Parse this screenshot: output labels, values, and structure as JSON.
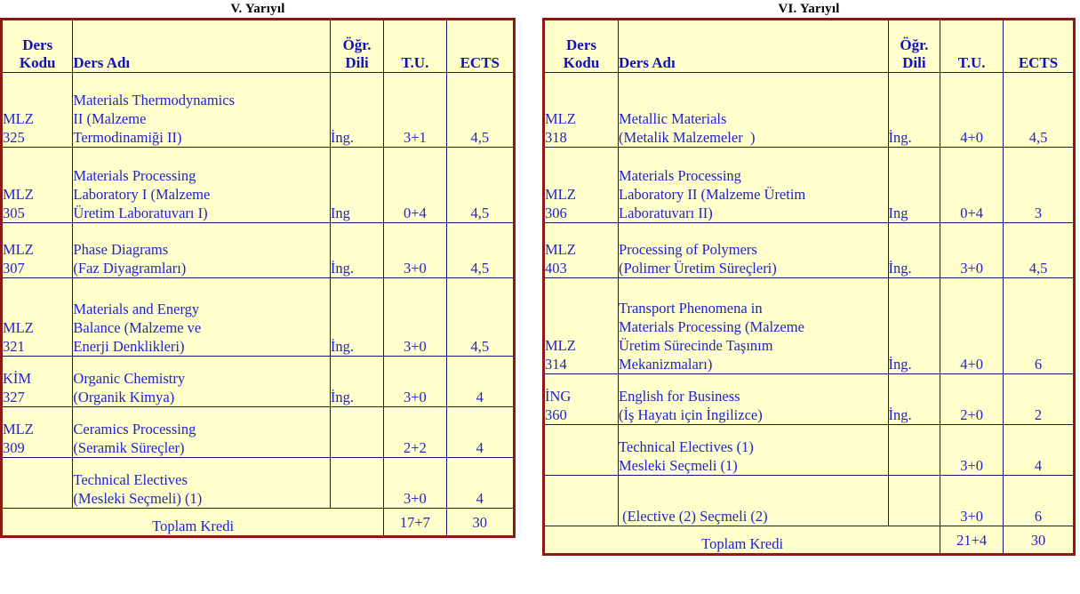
{
  "semesters": [
    {
      "title": "V. Yarıyıl",
      "columns": {
        "code": "Ders\nKodu",
        "code_line1": "Ders",
        "code_line2": "Kodu",
        "name": "Ders Adı",
        "lang_line1": "Öğr.",
        "lang_line2": "Dili",
        "tu": "T.U.",
        "ects": "ECTS"
      },
      "rows": [
        {
          "code_line1": "MLZ",
          "code_line2": "325",
          "name_lines": [
            "Materials Thermodynamics",
            "II (Malzeme",
            "Termodinamiği II)"
          ],
          "lang": "İng.",
          "tu": "3+1",
          "ects": "4,5"
        },
        {
          "code_line1": "MLZ",
          "code_line2": "305",
          "name_lines": [
            "Materials Processing",
            "Laboratory I (Malzeme",
            "Üretim Laboratuvarı I)"
          ],
          "lang": "Ing",
          "tu": "0+4",
          "ects": "4,5"
        },
        {
          "code_line1": "MLZ",
          "code_line2": "307",
          "name_lines": [
            "Phase Diagrams",
            "(Faz Diyagramları)"
          ],
          "lang": "İng.",
          "tu": "3+0",
          "ects": "4,5"
        },
        {
          "code_line1": "MLZ",
          "code_line2": "321",
          "name_lines": [
            "Materials and Energy",
            "Balance (Malzeme ve",
            "Enerji Denklikleri)"
          ],
          "lang": "İng.",
          "tu": "3+0",
          "ects": "4,5"
        },
        {
          "code_line1": "KİM",
          "code_line2": "327",
          "name_lines": [
            "Organic Chemistry",
            "(Organik Kimya)"
          ],
          "lang": "İng.",
          "tu": "3+0",
          "ects": "4"
        },
        {
          "code_line1": "MLZ",
          "code_line2": "309",
          "name_lines": [
            "Ceramics Processing",
            "(Seramik Süreçler)"
          ],
          "lang": "",
          "tu": "2+2",
          "ects": "4"
        },
        {
          "code_line1": "",
          "code_line2": "",
          "name_lines": [
            "Technical Electives",
            "(Mesleki Seçmeli) (1)"
          ],
          "lang": "",
          "tu": "3+0",
          "ects": "4"
        }
      ],
      "total": {
        "label": "Toplam Kredi",
        "tu": "17+7",
        "ects": "30"
      }
    },
    {
      "title": "VI. Yarıyıl",
      "columns": {
        "code": "Ders\nKodu",
        "code_line1": "Ders",
        "code_line2": "Kodu",
        "name": "Ders Adı",
        "lang_line1": "Öğr.",
        "lang_line2": "Dili",
        "tu": "T.U.",
        "ects": "ECTS"
      },
      "rows": [
        {
          "code_line1": "MLZ",
          "code_line2": "318",
          "name_lines": [
            "Metallic Materials",
            "(Metalik Malzemeler  )"
          ],
          "lang": "İng.",
          "tu": "4+0",
          "ects": "4,5"
        },
        {
          "code_line1": "MLZ",
          "code_line2": "306",
          "name_lines": [
            "Materials Processing",
            "Laboratory II (Malzeme Üretim",
            "Laboratuvarı II)"
          ],
          "lang": "Ing",
          "tu": "0+4",
          "ects": "3"
        },
        {
          "code_line1": "MLZ",
          "code_line2": "403",
          "name_lines": [
            "Processing of Polymers",
            "(Polimer Üretim Süreçleri)"
          ],
          "lang": "İng.",
          "tu": "3+0",
          "ects": "4,5"
        },
        {
          "code_line1": "MLZ",
          "code_line2": "314",
          "name_lines": [
            "Transport Phenomena in",
            "Materials Processing (Malzeme",
            "Üretim Sürecinde Taşınım",
            "Mekanizmaları)"
          ],
          "lang": "İng.",
          "tu": "4+0",
          "ects": "6"
        },
        {
          "code_line1": "İNG",
          "code_line2": "360",
          "name_lines": [
            "English for Business",
            "(İş Hayatı için İngilizce)"
          ],
          "lang": "İng.",
          "tu": "2+0",
          "ects": "2"
        },
        {
          "code_line1": "",
          "code_line2": "",
          "name_lines": [
            "Technical Electives (1)",
            "Mesleki Seçmeli (1)"
          ],
          "lang": "",
          "tu": "3+0",
          "ects": "4"
        },
        {
          "code_line1": "",
          "code_line2": "",
          "name_lines": [
            " (Elective (2) Seçmeli (2)"
          ],
          "lang": "",
          "tu": "3+0",
          "ects": "6"
        }
      ],
      "total": {
        "label": "Toplam Kredi",
        "tu": "21+4",
        "ects": "30"
      }
    }
  ],
  "colors": {
    "table_background": "#ffffcc",
    "outer_border": "#8b1a12",
    "inner_border": "#16166b",
    "header_text": "#1111bb",
    "body_text": "#2222cc",
    "title_text": "#000000"
  }
}
